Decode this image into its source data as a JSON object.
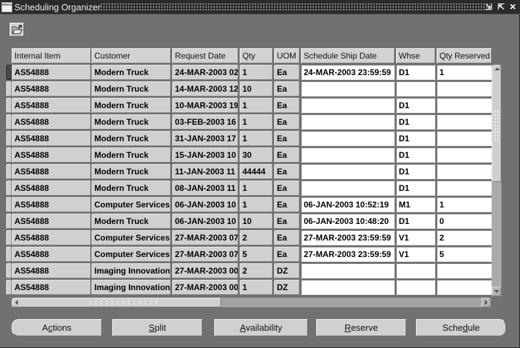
{
  "window": {
    "title": "Scheduling Organizer",
    "app_icon_label": "ORACLE",
    "controls": [
      {
        "name": "minimize-icon",
        "glyph": "⇲"
      },
      {
        "name": "maximize-icon",
        "glyph": "⇱"
      },
      {
        "name": "close-icon",
        "glyph": "✕"
      }
    ]
  },
  "toolbar": {
    "open_folder_icon": "folder-open-icon"
  },
  "table": {
    "columns": [
      "Internal Item",
      "Customer",
      "Request Date",
      "Qty",
      "UOM",
      "Schedule Ship Date",
      "Whse",
      "Qty Reserved"
    ],
    "rows": [
      [
        "AS54888",
        "Modern Truck",
        "24-MAR-2003 02",
        "1",
        "Ea",
        "24-MAR-2003 23:59:59",
        "D1",
        "1"
      ],
      [
        "AS54888",
        "Modern Truck",
        "14-MAR-2003 12",
        "10",
        "Ea",
        "",
        "",
        ""
      ],
      [
        "AS54888",
        "Modern Truck",
        "10-MAR-2003 19",
        "1",
        "Ea",
        "",
        "D1",
        ""
      ],
      [
        "AS54888",
        "Modern Truck",
        "03-FEB-2003 16",
        "1",
        "Ea",
        "",
        "D1",
        ""
      ],
      [
        "AS54888",
        "Modern Truck",
        "31-JAN-2003 17",
        "1",
        "Ea",
        "",
        "D1",
        ""
      ],
      [
        "AS54888",
        "Modern Truck",
        "15-JAN-2003 10",
        "30",
        "Ea",
        "",
        "D1",
        ""
      ],
      [
        "AS54888",
        "Modern Truck",
        "11-JAN-2003 11",
        "44444",
        "Ea",
        "",
        "D1",
        ""
      ],
      [
        "AS54888",
        "Modern Truck",
        "08-JAN-2003 11",
        "1",
        "Ea",
        "",
        "D1",
        ""
      ],
      [
        "AS54888",
        "Computer Services",
        "06-JAN-2003 10",
        "1",
        "Ea",
        "06-JAN-2003 10:52:19",
        "M1",
        "1"
      ],
      [
        "AS54888",
        "Modern Truck",
        "06-JAN-2003 10",
        "10",
        "Ea",
        "06-JAN-2003 10:48:20",
        "D1",
        "0"
      ],
      [
        "AS54888",
        "Computer Services",
        "27-MAR-2003 07",
        "2",
        "Ea",
        "27-MAR-2003 23:59:59",
        "V1",
        "2"
      ],
      [
        "AS54888",
        "Computer Services",
        "27-MAR-2003 07",
        "5",
        "Ea",
        "27-MAR-2003 23:59:59",
        "V1",
        "5"
      ],
      [
        "AS54888",
        "Imaging Innovations",
        "27-MAR-2003 00",
        "2",
        "DZ",
        "",
        "",
        ""
      ],
      [
        "AS54888",
        "Imaging Innovations",
        "27-MAR-2003 00",
        "1",
        "DZ",
        "",
        "",
        ""
      ]
    ],
    "current_row": 0
  },
  "buttons": [
    {
      "pre": "A",
      "key": "c",
      "post": "tions"
    },
    {
      "pre": "",
      "key": "S",
      "post": "plit"
    },
    {
      "pre": "",
      "key": "A",
      "post": "vailability"
    },
    {
      "pre": "",
      "key": "R",
      "post": "eserve"
    },
    {
      "pre": "Sche",
      "key": "d",
      "post": "ule"
    }
  ],
  "colors": {
    "window_bg": "#717171",
    "titlebar_bg": "#2b2b2b",
    "readonly_cell": "#d0d0d0",
    "editable_cell": "#ffffff"
  }
}
